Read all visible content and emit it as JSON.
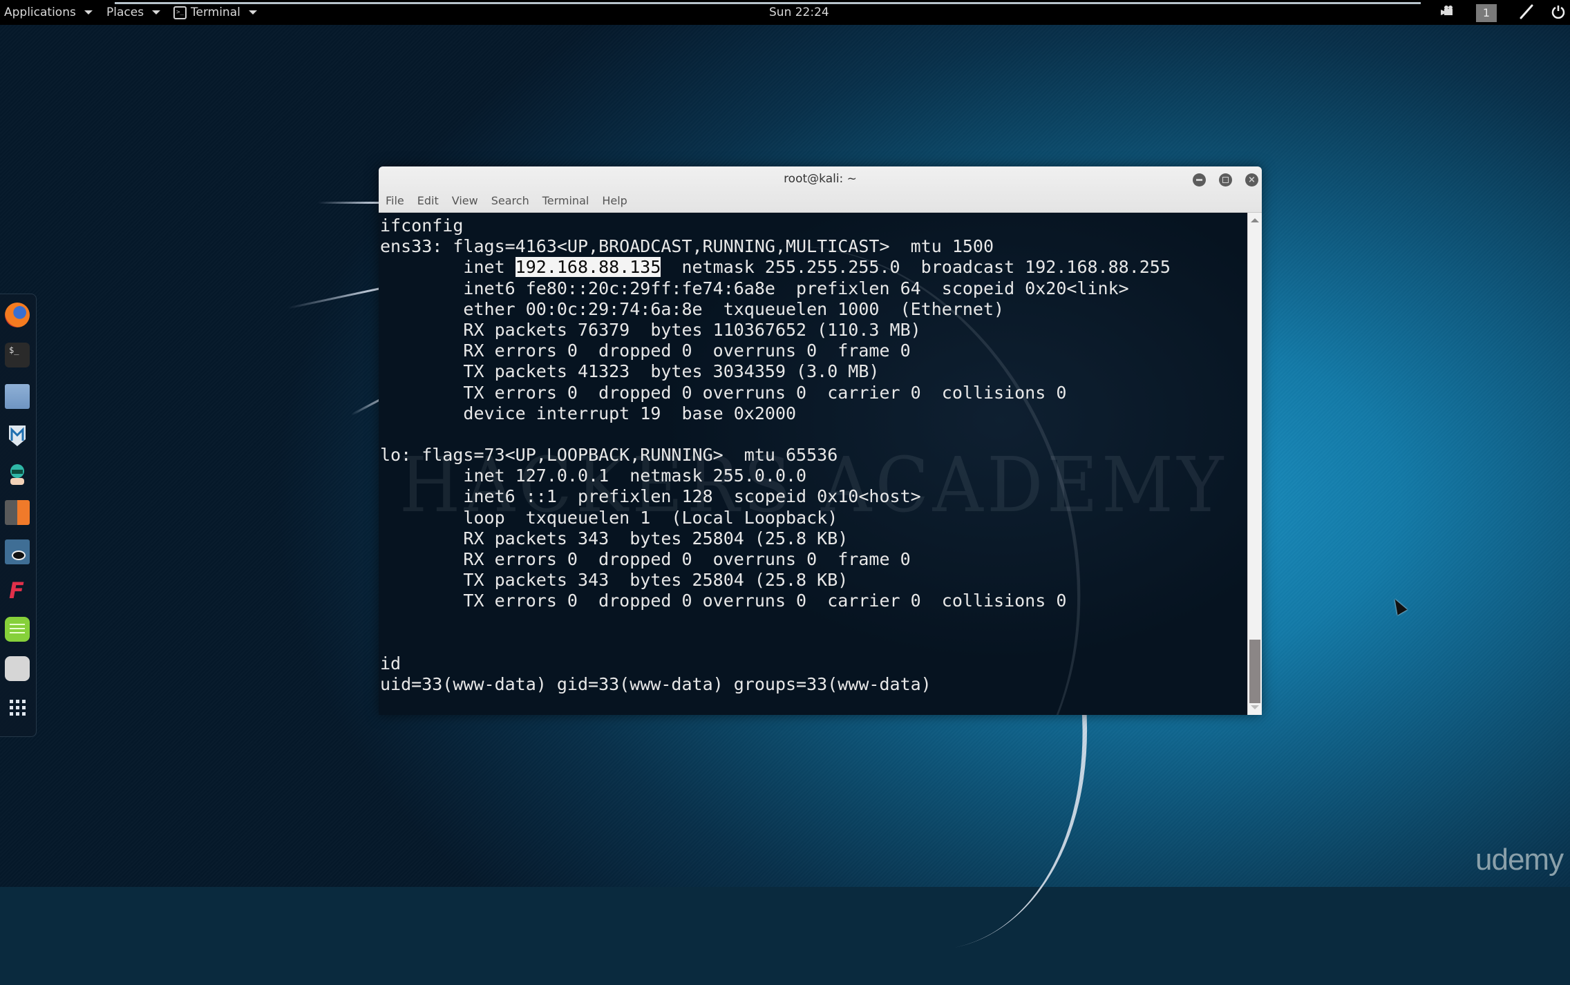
{
  "topbar": {
    "applications_label": "Applications",
    "places_label": "Places",
    "active_app_label": "Terminal",
    "clock": "Sun 22:24",
    "workspace_number": "1",
    "icons": [
      "recording-camera-icon",
      "accessibility-icon",
      "power-icon"
    ]
  },
  "dock": {
    "items": [
      {
        "name": "firefox",
        "icon": "firefox-icon"
      },
      {
        "name": "terminal",
        "icon": "terminal-icon"
      },
      {
        "name": "files",
        "icon": "folder-icon"
      },
      {
        "name": "metasploit",
        "icon": "metasploit-icon"
      },
      {
        "name": "armitage",
        "icon": "armitage-icon"
      },
      {
        "name": "burpsuite",
        "icon": "burpsuite-icon"
      },
      {
        "name": "maltego",
        "icon": "maltego-icon"
      },
      {
        "name": "faraday",
        "icon": "faraday-icon"
      },
      {
        "name": "leafpad",
        "icon": "notes-icon"
      },
      {
        "name": "cherrytree",
        "icon": "app-icon"
      },
      {
        "name": "show-applications",
        "icon": "app-grid-icon"
      }
    ]
  },
  "terminal": {
    "title": "root@kali: ~",
    "menu": [
      "File",
      "Edit",
      "View",
      "Search",
      "Terminal",
      "Help"
    ],
    "watermark": "HACKERS ACADEMY",
    "lines": [
      "ifconfig",
      "ens33: flags=4163<UP,BROADCAST,RUNNING,MULTICAST>  mtu 1500",
      {
        "prefix": "        inet ",
        "highlight": "192.168.88.135",
        "suffix": "  netmask 255.255.255.0  broadcast 192.168.88.255"
      },
      "        inet6 fe80::20c:29ff:fe74:6a8e  prefixlen 64  scopeid 0x20<link>",
      "        ether 00:0c:29:74:6a:8e  txqueuelen 1000  (Ethernet)",
      "        RX packets 76379  bytes 110367652 (110.3 MB)",
      "        RX errors 0  dropped 0  overruns 0  frame 0",
      "        TX packets 41323  bytes 3034359 (3.0 MB)",
      "        TX errors 0  dropped 0 overruns 0  carrier 0  collisions 0",
      "        device interrupt 19  base 0x2000",
      "",
      "lo: flags=73<UP,LOOPBACK,RUNNING>  mtu 65536",
      "        inet 127.0.0.1  netmask 255.0.0.0",
      "        inet6 ::1  prefixlen 128  scopeid 0x10<host>",
      "        loop  txqueuelen 1  (Local Loopback)",
      "        RX packets 343  bytes 25804 (25.8 KB)",
      "        RX errors 0  dropped 0  overruns 0  frame 0",
      "        TX packets 343  bytes 25804 (25.8 KB)",
      "        TX errors 0  dropped 0 overruns 0  carrier 0  collisions 0",
      "",
      "",
      "id",
      "uid=33(www-data) gid=33(www-data) groups=33(www-data)"
    ],
    "scroll_position_fraction": 0.95
  },
  "watermark_brand": "udemy"
}
